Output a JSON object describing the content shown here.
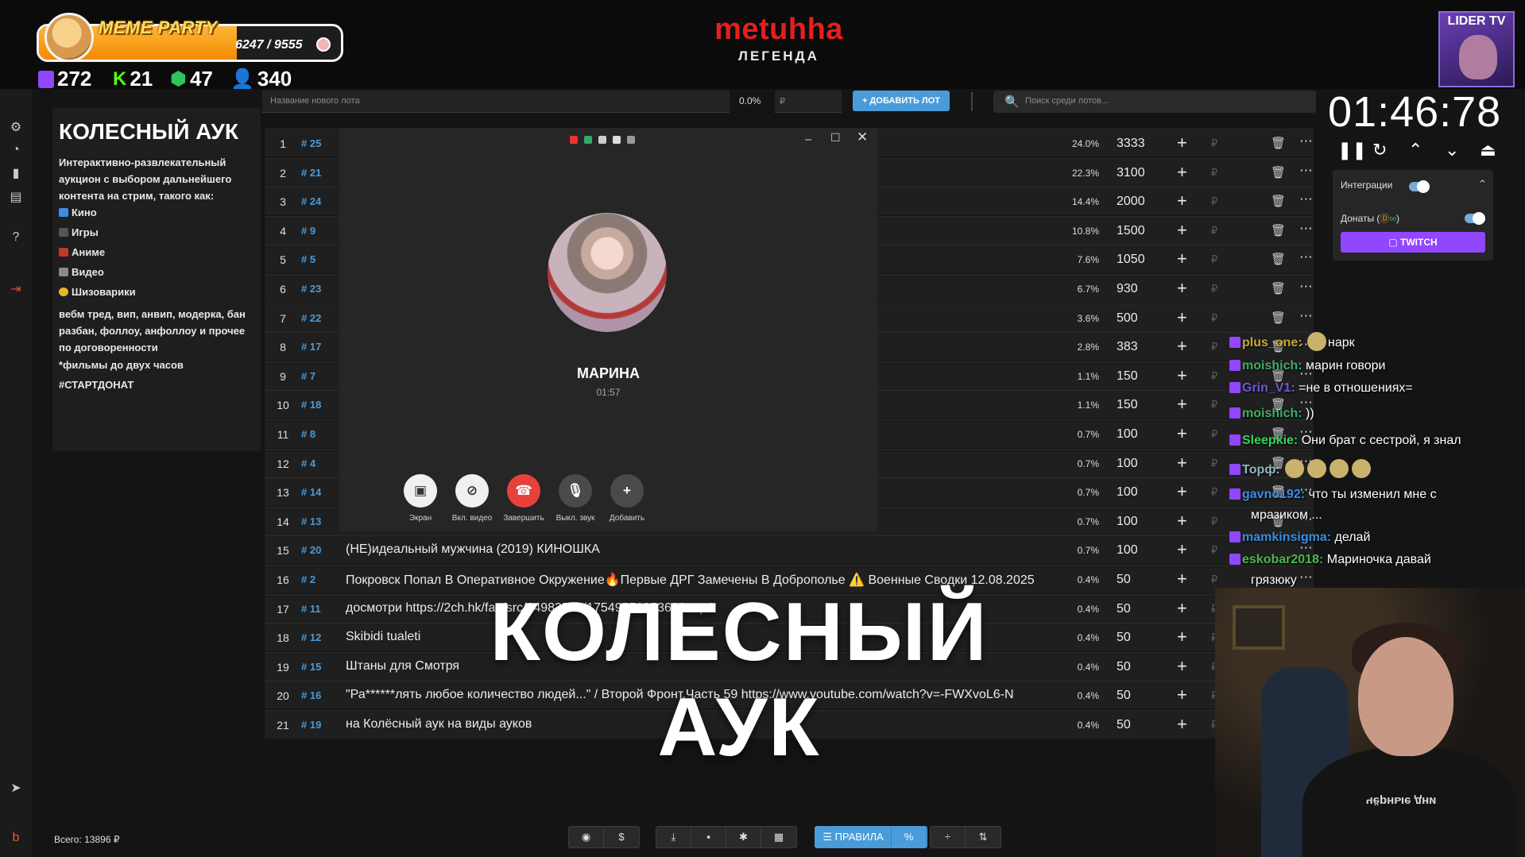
{
  "overlay": {
    "meme_title": "MEME PARTY",
    "meme_progress": "6247 / 9555",
    "meme_progress_fraction": 0.654,
    "brand_name": "metuhha",
    "brand_sub": "ЛЕГЕНДА",
    "lider_label": "LIDER TV",
    "stats": {
      "twitch": "272",
      "kick": "21",
      "shield": "47",
      "viewers": "340"
    }
  },
  "info": {
    "title": "КОЛЕСНЫЙ АУК",
    "desc": "Интерактивно-развлекательный аукцион с выбором дальнейшего контента на стрим, такого как:",
    "cats": [
      "Кино",
      "Игры",
      "Аниме",
      "Видео",
      "Шизоварики"
    ],
    "extra": "вебм тред, вип, анвип, модерка, бан разбан, фоллоу, анфоллоу и прочее по договоренности",
    "films": "*фильмы до двух часов",
    "tag": "#СТАРТДОНАТ"
  },
  "controls": {
    "newlot_placeholder": "Название нового лота",
    "pct": "0.0%",
    "rub": "₽",
    "add_lot": "+ ДОБАВИТЬ ЛОТ",
    "search_placeholder": "Поиск среди лотов..."
  },
  "lots": [
    {
      "n": "1",
      "id": "# 25",
      "name": "",
      "pct": "24.0%",
      "amt": "3333"
    },
    {
      "n": "2",
      "id": "# 21",
      "name": "",
      "pct": "22.3%",
      "amt": "3100"
    },
    {
      "n": "3",
      "id": "# 24",
      "name": "",
      "pct": "14.4%",
      "amt": "2000"
    },
    {
      "n": "4",
      "id": "# 9",
      "name": "",
      "pct": "10.8%",
      "amt": "1500"
    },
    {
      "n": "5",
      "id": "# 5",
      "name": "",
      "pct": "7.6%",
      "amt": "1050"
    },
    {
      "n": "6",
      "id": "# 23",
      "name": "",
      "pct": "6.7%",
      "amt": "930"
    },
    {
      "n": "7",
      "id": "# 22",
      "name": "",
      "pct": "3.6%",
      "amt": "500"
    },
    {
      "n": "8",
      "id": "# 17",
      "name": "",
      "pct": "2.8%",
      "amt": "383"
    },
    {
      "n": "9",
      "id": "# 7",
      "name": "",
      "pct": "1.1%",
      "amt": "150"
    },
    {
      "n": "10",
      "id": "# 18",
      "name": "",
      "pct": "1.1%",
      "amt": "150"
    },
    {
      "n": "11",
      "id": "# 8",
      "name": "",
      "pct": "0.7%",
      "amt": "100"
    },
    {
      "n": "12",
      "id": "# 4",
      "name": "",
      "pct": "0.7%",
      "amt": "100"
    },
    {
      "n": "13",
      "id": "# 14",
      "name": "",
      "pct": "0.7%",
      "amt": "100"
    },
    {
      "n": "14",
      "id": "# 13",
      "name": "",
      "pct": "0.7%",
      "amt": "100"
    },
    {
      "n": "15",
      "id": "# 20",
      "name": "(НЕ)идеальный мужчина (2019) КИНОШКА",
      "pct": "0.7%",
      "amt": "100"
    },
    {
      "n": "16",
      "id": "# 2",
      "name": "Покровск Попал В Оперативное Окружение🔥Первые ДРГ Замечены В Доброполье ⚠️ Военные Сводки 12.08.2025",
      "pct": "0.4%",
      "amt": "50"
    },
    {
      "n": "17",
      "id": "# 11",
      "name": "досмотри https://2ch.hk/faq/src/24983598/17549571353600.mp4",
      "pct": "0.4%",
      "amt": "50"
    },
    {
      "n": "18",
      "id": "# 12",
      "name": "Skibidi tualeti",
      "pct": "0.4%",
      "amt": "50"
    },
    {
      "n": "19",
      "id": "# 15",
      "name": "Штаны для Смотря",
      "pct": "0.4%",
      "amt": "50"
    },
    {
      "n": "20",
      "id": "# 16",
      "name": "\"Ра******лять любое количество людей...\" / Второй Фронт.Часть 59 https://www.youtube.com/watch?v=-FWXvoL6-N",
      "pct": "0.4%",
      "amt": "50"
    },
    {
      "n": "21",
      "id": "# 19",
      "name": "на Колёсный аук на виды ауков",
      "pct": "0.4%",
      "amt": "50"
    }
  ],
  "call": {
    "name": "МАРИНА",
    "time": "01:57",
    "buttons": [
      "Экран",
      "Вкл. видео",
      "Завершить",
      "Выкл. звук",
      "Добавить"
    ]
  },
  "timer": {
    "time": "01:46:78"
  },
  "integrations": {
    "label": "Интеграции",
    "donations": "Донаты (",
    "donations_tail": ")",
    "twitch": "TWITCH"
  },
  "chat": [
    {
      "user": "plus_one:",
      "color": "#c8a93a",
      "text": "нарк"
    },
    {
      "user": "moishich:",
      "color": "#3fae63",
      "text": "марин говори"
    },
    {
      "user": "Grin_V1:",
      "color": "#6b5bd6",
      "text": "=не в отношениях="
    },
    {
      "user": "moishich:",
      "color": "#3fae63",
      "text": "))"
    },
    {
      "user": "Sleepkie:",
      "color": "#35d35a",
      "text": "Они брат с сестрой, я знал"
    },
    {
      "user": "Торф:",
      "color": "#8fb7c4",
      "text": ""
    },
    {
      "user": "gavno192:",
      "color": "#3b8ee0",
      "text": "что ты изменил мне с"
    },
    {
      "user": "",
      "color": "#fff",
      "text": "мразиком ..."
    },
    {
      "user": "mamkinsigma:",
      "color": "#3b8ee0",
      "text": "делай"
    },
    {
      "user": "eskobar2018:",
      "color": "#4ab84a",
      "text": "Мариночка давай"
    },
    {
      "user": "",
      "color": "#fff",
      "text": "грязюку"
    }
  ],
  "footer": {
    "total": "Всего: 13896 ₽",
    "rules": "ПРАВИЛА",
    "percent": "%"
  },
  "caption": {
    "line1": "КОЛЕСНЫЙ",
    "line2": "АУК"
  },
  "cam": {
    "shirt_text": "чёрные дни"
  },
  "colors": {
    "accent": "#4a9bd9",
    "twitch": "#9146ff",
    "brand_red": "#e3201e",
    "end_call": "#e8413c"
  }
}
